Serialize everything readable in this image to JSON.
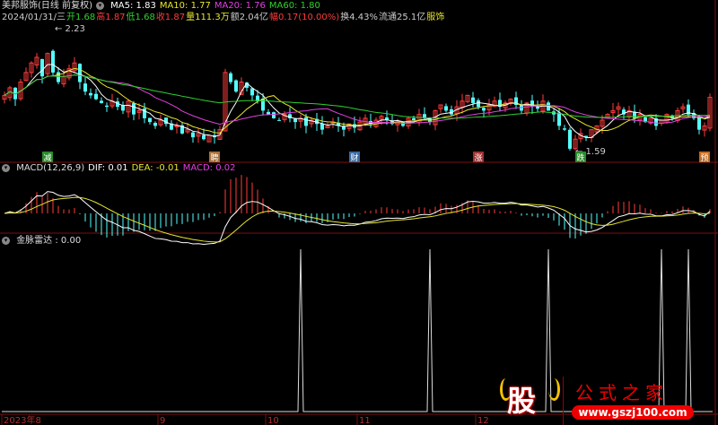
{
  "header": {
    "stock": "美邦服饰(日线 前复权)",
    "ma5": "MA5: 1.83",
    "ma10": "MA10: 1.77",
    "ma20": "MA20: 1.76",
    "ma60": "MA60: 1.80"
  },
  "quote": {
    "date": "2024/01/31/三",
    "open": "开1.68",
    "high": "高1.87",
    "low": "低1.68",
    "close": "收1.87",
    "vol": "量111.3万",
    "amount": "额2.04亿",
    "change": "幅0.17(10.00%)",
    "turnover": "换4.43%",
    "float": "流通25.1亿",
    "sector": "服饰"
  },
  "price_max_label": "2.23",
  "price_min_label": "1.59",
  "macd": {
    "title": "MACD(12,26,9)",
    "dif": "DIF: 0.01",
    "dea": "DEA: -0.01",
    "macd": "MACD: 0.02"
  },
  "radar": {
    "title": "金脉雷达 : 0.00",
    "spike_indices": [
      55,
      79,
      101,
      122,
      127
    ]
  },
  "axis": {
    "labels": [
      {
        "text": "2023年8",
        "i": 0
      },
      {
        "text": "9",
        "i": 29
      },
      {
        "text": "10",
        "i": 49
      },
      {
        "text": "11",
        "i": 66
      },
      {
        "text": "12",
        "i": 88
      }
    ]
  },
  "signals": [
    {
      "text": "减",
      "i": 8,
      "color": "#2a8a2a"
    },
    {
      "text": "聘",
      "i": 39,
      "color": "#a8703a"
    },
    {
      "text": "财",
      "i": 65,
      "color": "#3a6aa0"
    },
    {
      "text": "涨",
      "i": 88,
      "color": "#a03030"
    },
    {
      "text": "跌",
      "i": 107,
      "color": "#2a8a2a"
    },
    {
      "text": "预",
      "i": 130,
      "color": "#c06a20"
    }
  ],
  "colors": {
    "up": "#ff3b3b",
    "down": "#54ffff",
    "ma5": "#ffffff",
    "ma10": "#e6e62e",
    "ma20": "#e040e0",
    "ma60": "#30d030"
  },
  "closes": [
    1.88,
    1.92,
    1.86,
    1.95,
    2.0,
    2.05,
    2.08,
    1.98,
    2.1,
    2.0,
    1.95,
    1.98,
    2.02,
    2.05,
    1.95,
    1.9,
    1.88,
    1.86,
    1.84,
    1.82,
    1.85,
    1.82,
    1.8,
    1.85,
    1.78,
    1.8,
    1.76,
    1.74,
    1.72,
    1.75,
    1.73,
    1.7,
    1.72,
    1.68,
    1.7,
    1.66,
    1.68,
    1.65,
    1.67,
    1.66,
    1.7,
    2.0,
    1.95,
    1.9,
    1.95,
    1.92,
    1.88,
    1.85,
    1.8,
    1.78,
    1.76,
    1.75,
    1.78,
    1.76,
    1.74,
    1.76,
    1.72,
    1.75,
    1.73,
    1.7,
    1.72,
    1.74,
    1.72,
    1.7,
    1.73,
    1.71,
    1.74,
    1.76,
    1.73,
    1.75,
    1.77,
    1.75,
    1.73,
    1.74,
    1.72,
    1.76,
    1.75,
    1.78,
    1.76,
    1.74,
    1.8,
    1.83,
    1.8,
    1.78,
    1.82,
    1.85,
    1.88,
    1.84,
    1.82,
    1.8,
    1.83,
    1.85,
    1.82,
    1.84,
    1.86,
    1.83,
    1.8,
    1.84,
    1.82,
    1.81,
    1.85,
    1.8,
    1.78,
    1.72,
    1.7,
    1.6,
    1.65,
    1.68,
    1.66,
    1.7,
    1.72,
    1.75,
    1.78,
    1.8,
    1.82,
    1.78,
    1.8,
    1.76,
    1.78,
    1.74,
    1.76,
    1.72,
    1.75,
    1.78,
    1.76,
    1.8,
    1.82,
    1.78,
    1.76,
    1.7,
    1.72,
    1.87
  ],
  "logo": {
    "brand": "股",
    "name": "公式之家",
    "url": "www.gszj100.com"
  }
}
